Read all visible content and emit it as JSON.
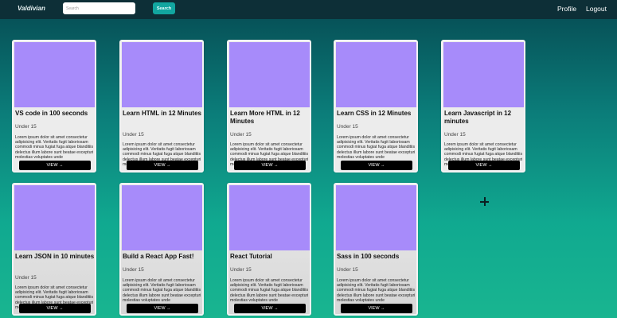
{
  "navbar": {
    "brand": "Valdivian",
    "search_placeholder": "Search",
    "search_button": "Search",
    "profile_link": "Profile",
    "logout_link": "Logout"
  },
  "cards": [
    {
      "title": "VS code in 100 seconds",
      "subtitle": "Under 15",
      "description": "Lorem ipsum dolor sit amet consectetur adipisicing elit. Veritatis fugit laboriosam commodi minus fugiat fuga atque blanditiis delectus illum labore sunt beatae excepturi molestias voluptates unde",
      "button": "VIEW →",
      "thumb_color": "#a78bfa"
    },
    {
      "title": "Learn HTML in 12 Minutes",
      "subtitle": "Under 15",
      "description": "Lorem ipsum dolor sit amet consectetur adipisicing elit. Veritatis fugit laboriosam commodi minus fugiat fuga atque blanditiis delectus illum labore sunt beatae excepturi molestias voluptates unde",
      "button": "VIEW →",
      "thumb_color": "#a78bfa"
    },
    {
      "title": "Learn More HTML in 12 Minutes",
      "subtitle": "Under 15",
      "description": "Lorem ipsum dolor sit amet consectetur adipisicing elit. Veritatis fugit laboriosam commodi minus fugiat fuga atque blanditiis delectus illum labore sunt beatae excepturi molestias voluptates unde",
      "button": "VIEW →",
      "thumb_color": "#a78bfa"
    },
    {
      "title": "Learn CSS in 12 Minutes",
      "subtitle": "Under 15",
      "description": "Lorem ipsum dolor sit amet consectetur adipisicing elit. Veritatis fugit laboriosam commodi minus fugiat fuga atque blanditiis delectus illum labore sunt beatae excepturi molestias voluptates unde",
      "button": "VIEW →",
      "thumb_color": "#a78bfa"
    },
    {
      "title": "Learn Javascript in 12 minutes",
      "subtitle": "Under 15",
      "description": "Lorem ipsum dolor sit amet consectetur adipisicing elit. Veritatis fugit laboriosam commodi minus fugiat fuga atque blanditiis delectus illum labore sunt beatae excepturi molestias voluptates unde",
      "button": "VIEW →",
      "thumb_color": "#a78bfa"
    },
    {
      "title": "Learn JSON in 10 minutes",
      "subtitle": "Under 15",
      "description": "Lorem ipsum dolor sit amet consectetur adipisicing elit. Veritatis fugit laboriosam commodi minus fugiat fuga atque blanditiis delectus illum labore sunt beatae excepturi molestias voluptates unde",
      "button": "VIEW →",
      "thumb_color": "#a78bfa"
    },
    {
      "title": "Build a React App Fast!",
      "subtitle": "Under 15",
      "description": "Lorem ipsum dolor sit amet consectetur adipisicing elit. Veritatis fugit laboriosam commodi minus fugiat fuga atque blanditiis delectus illum labore sunt beatae excepturi molestias voluptates unde",
      "button": "VIEW →",
      "thumb_color": "#a78bfa"
    },
    {
      "title": "React Tutorial",
      "subtitle": "Under 15",
      "description": "Lorem ipsum dolor sit amet consectetur adipisicing elit. Veritatis fugit laboriosam commodi minus fugiat fuga atque blanditiis delectus illum labore sunt beatae excepturi molestias voluptates unde",
      "button": "VIEW →",
      "thumb_color": "#a78bfa"
    },
    {
      "title": "Sass in 100 seconds",
      "subtitle": "Under 15",
      "description": "Lorem ipsum dolor sit amet consectetur adipisicing elit. Veritatis fugit laboriosam commodi minus fugiat fuga atque blanditiis delectus illum labore sunt beatae excepturi molestias voluptates unde",
      "button": "VIEW →",
      "thumb_color": "#a78bfa"
    }
  ]
}
